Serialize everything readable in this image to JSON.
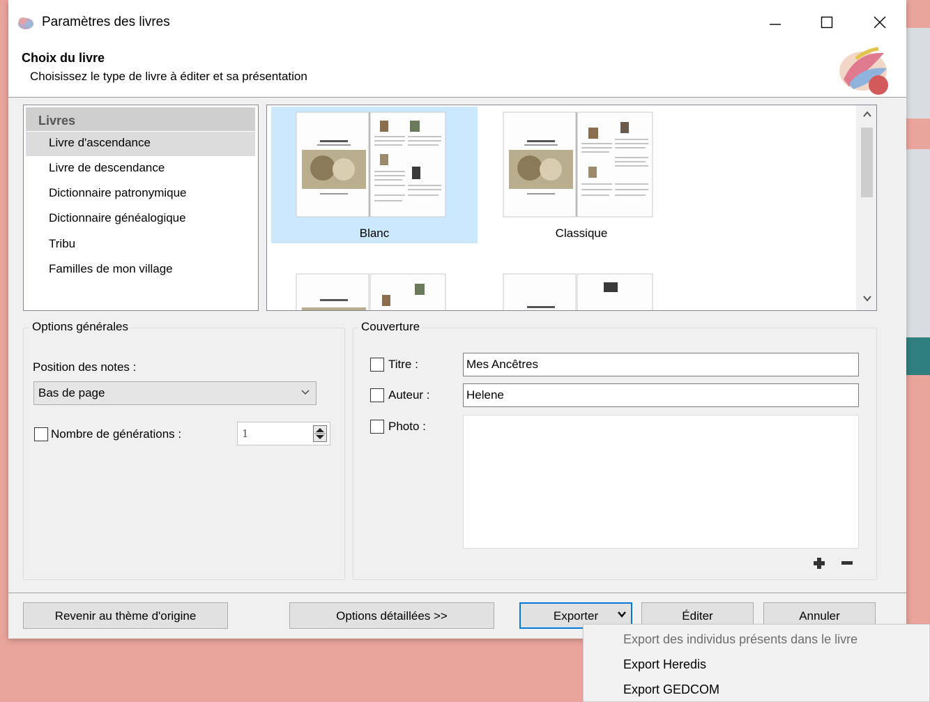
{
  "window": {
    "title": "Paramètres des livres"
  },
  "header": {
    "title": "Choix du livre",
    "subtitle": "Choisissez le type de livre à éditer et sa présentation"
  },
  "book_list": {
    "header": "Livres",
    "items": [
      {
        "label": "Livre d'ascendance",
        "selected": true
      },
      {
        "label": "Livre de descendance"
      },
      {
        "label": "Dictionnaire patronymique"
      },
      {
        "label": "Dictionnaire généalogique"
      },
      {
        "label": "Tribu"
      },
      {
        "label": "Familles de mon village"
      }
    ]
  },
  "themes": [
    {
      "label": "Blanc",
      "selected": true
    },
    {
      "label": "Classique"
    }
  ],
  "general_options": {
    "group_label": "Options générales",
    "notes_position_label": "Position des notes :",
    "notes_position_value": "Bas de page",
    "generations_label": "Nombre de générations :",
    "generations_value": "1"
  },
  "cover": {
    "group_label": "Couverture",
    "title_label": "Titre :",
    "title_value": "Mes Ancêtres",
    "author_label": "Auteur :",
    "author_value": "Helene",
    "photo_label": "Photo :"
  },
  "buttons": {
    "reset_theme": "Revenir au thème d'origine",
    "detailed_options": "Options détaillées >>",
    "export": "Exporter",
    "edit": "Éditer",
    "cancel": "Annuler"
  },
  "export_menu": {
    "items": [
      {
        "label": "Export des individus présents dans le livre",
        "disabled": true
      },
      {
        "label": "Export Heredis"
      },
      {
        "label": "Export GEDCOM"
      }
    ]
  },
  "colors": {
    "selection": "#cce8ff",
    "accent": "#0078d7",
    "background_app": "#e9a49c"
  }
}
